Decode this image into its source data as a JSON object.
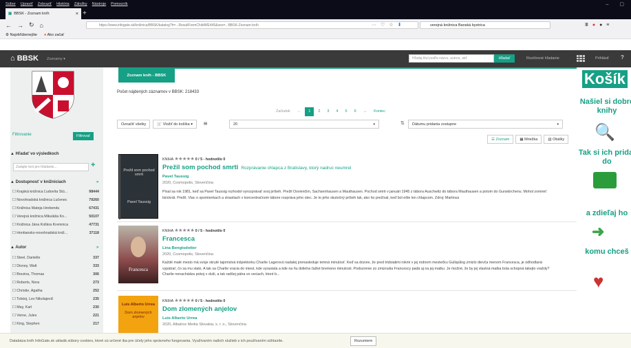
{
  "browser": {
    "menu": [
      "Súbor",
      "Upraviť",
      "Zobraziť",
      "História",
      "Záložky",
      "Nástroje",
      "Pomocník"
    ],
    "tab_title": "BBSK - Zoznam kníh",
    "url": "https://www.infogate.sk/knižnica/BBSK/katalog?h=...ResultFormChildWE445&seo=...BBSK-Zoznam-kníh",
    "search_value": "verejná knižnica Banská bystrica",
    "bookmarks": [
      "Najobľúbenejšie",
      "Ako začať"
    ]
  },
  "site": {
    "logo": "BBSK",
    "zoznamy": "Zoznamy",
    "search_placeholder": "Hľadaj titul podľa názvu, autora, atď.",
    "search_button": "Hľadať",
    "advanced": "Rozšírené hľadanie",
    "login": "Prihlásiť",
    "help": "?"
  },
  "filters": {
    "label": "Filtrovanie",
    "button": "Filtrovať",
    "search_head": "Hľadať vo výsledkoch",
    "search_placeholder": "Zadajte text pre hľadanie...",
    "availability_head": "Dostupnosť v knižniciach",
    "availability": [
      {
        "name": "Krajská knižnica Ľudovíta Štú...",
        "count": "98444"
      },
      {
        "name": "Novohradská knižnica Lučenec",
        "count": "79260"
      },
      {
        "name": "Knižnica Mateja Hrebendu",
        "count": "67431"
      },
      {
        "name": "Verejná knižnica Mikuláša Ko...",
        "count": "50107"
      },
      {
        "name": "Knižnica Jána Kollára Kremnica",
        "count": "47731"
      },
      {
        "name": "Hontiansko-novohradská kniž...",
        "count": "37118"
      }
    ],
    "author_head": "Autor",
    "authors": [
      {
        "name": "Steel, Danielle",
        "count": "337"
      },
      {
        "name": "Disney, Walt",
        "count": "333"
      },
      {
        "name": "Brezina, Thomas",
        "count": "306"
      },
      {
        "name": "Roberts, Nora",
        "count": "273"
      },
      {
        "name": "Christie, Agatha",
        "count": "252"
      },
      {
        "name": "Tolstoj, Lev Nikolajevič",
        "count": "235"
      },
      {
        "name": "May, Karl",
        "count": "230"
      },
      {
        "name": "Verne, Jules",
        "count": "221"
      },
      {
        "name": "King, Stephen",
        "count": "217"
      }
    ]
  },
  "main": {
    "badge": "Zoznam kníh - BBSK",
    "count_text": "Počet nájdených záznamov v BBSK: 218433",
    "pager": {
      "start": "Začiatok",
      "prev": "←",
      "pages": [
        "1",
        "2",
        "3",
        "4",
        "5",
        "6"
      ],
      "next": "→",
      "end": "Koniec"
    },
    "clear_all": "Označiť všetky",
    "add_to_cart": "Vložiť do košíka",
    "per_page": "20",
    "sort": "Dátumu pridania zostupne",
    "views": [
      "Zoznam",
      "Mriežka",
      "Obálky"
    ],
    "books": [
      {
        "type": "KNIHA",
        "rating": "0 / 5 - hodnotilo 0",
        "title": "Prežil som pochod smrti",
        "subtitle": "Rozprávanie chlapca z Bratislavy, ktorý nadruc neumrel",
        "author": "Pavel Taussig",
        "pub": "2020, Cosmopolis, Slovenčina",
        "cover_title": "Prežil som pochod smrti",
        "cover_author": "Pavel Taussig",
        "desc": "Písal sa rok 1981, keď sa Pavel Taussig rozhodol vyrozprávať svoj príbeh. Prežil Osvienčim, Sachsenhausen a Mauthausen. Pochod smrti v januári 1945 z tábora Auschwitz do tábora Mauthausen a potom do Gunskirchenu. Mohol zomrieť tisíckrát. Prežil. Viac o spomienkach a strastiach v koncentračnom tábore rozpráva jeho otec. Je to jeho skutočný príbeh lak, ako ho prežíval, keď bol ešte len chlapcom. Zdroj: Martinus"
      },
      {
        "type": "KNIHA",
        "rating": "0 / 5 - hodnotilo 0",
        "title": "Francesca",
        "subtitle": "",
        "author": "Lina Bengtsdotter",
        "pub": "2020, Cosmopolis, Slovenčina",
        "cover_title": "Francesca",
        "cover_author": "",
        "desc": "Každé malé mesto má svoje skryté tajomstvá inšpektorku Charlie Lagerovú nadalej prenasleduje temná minulosť. Keď sa dozvie, že pred tridsiatimi rokmi v jej rodnom mestečku Gullspång zmizlo dievča menom Francesca, je odhodlaná vypátrať, čo sa mu stalo. A tak sa Charlie vracia do miest, kde vyrastala a kde na ňu dolieha ťažké bremeno minulosti. Podozrenie zo zmiznutia Francescy padá aj na jej matku. Je možné, že by jej vlastná matka bola schopná takejto vraždy? Charlie nenachádza pokoj v duši, a tak radšej pátra vo veciach, ktoré b..."
      },
      {
        "type": "KNIHA",
        "rating": "0 / 5 - hodnotilo 0",
        "title": "Dom zlomených anjelov",
        "subtitle": "",
        "author": "Luis Alberto Urrea",
        "pub": "2020, Albatros Media Slovakia, s. r. o., Slovenčina",
        "cover_title": "Dom zlomených anjelov",
        "cover_author": "Luis Alberto Urrea",
        "desc": ""
      }
    ]
  },
  "ad": {
    "title": "Košík",
    "line1": "Našiel si dobré knihy",
    "line2": "Tak si ich pridaj do",
    "line3": "a zdieľaj ho",
    "line4": "komu chceš"
  },
  "cookie": {
    "text": "Databáza kníh InfoGate.sk ukladá súbory cookies, ktoré sú určené iba pre účely jeho správneho fungovania. Využívaním našich služieb s ich používaním súhlasíte.",
    "button": "Rozumiem"
  },
  "colors": {
    "accent": "#16a085",
    "header": "#3a3a3a"
  }
}
